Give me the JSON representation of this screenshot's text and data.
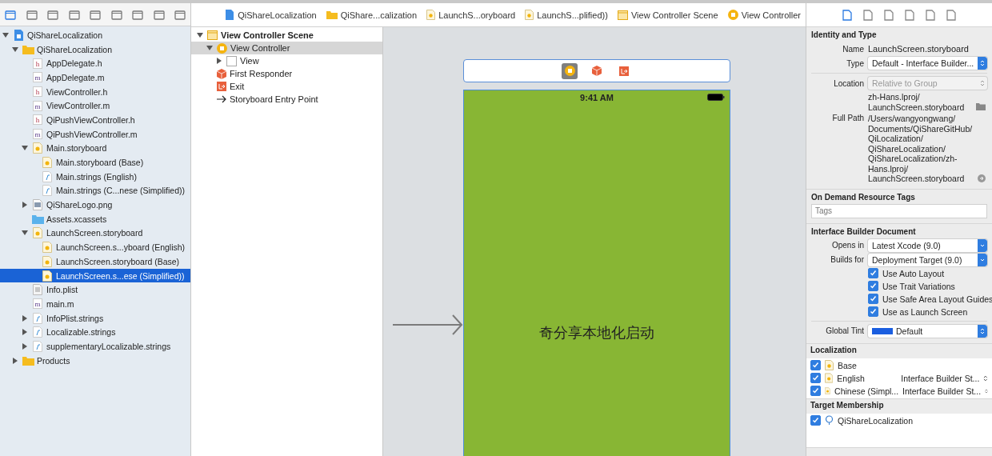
{
  "navigator": {
    "toolbar": [
      {
        "selected": true
      },
      {
        "selected": false
      },
      {
        "selected": false
      },
      {
        "selected": false
      },
      {
        "selected": false
      },
      {
        "selected": false
      },
      {
        "selected": false
      },
      {
        "selected": false
      },
      {
        "selected": false
      }
    ],
    "tree": [
      {
        "name": "QiShareLocalization",
        "kind": "project",
        "expanded": true,
        "selected": false,
        "children": [
          {
            "name": "QiShareLocalization",
            "kind": "folder",
            "expanded": true,
            "selected": false,
            "children": [
              {
                "name": "AppDelegate.h",
                "kind": "h",
                "selected": false
              },
              {
                "name": "AppDelegate.m",
                "kind": "m",
                "selected": false
              },
              {
                "name": "ViewController.h",
                "kind": "h",
                "selected": false
              },
              {
                "name": "ViewController.m",
                "kind": "m",
                "selected": false
              },
              {
                "name": "QiPushViewController.h",
                "kind": "h",
                "selected": false
              },
              {
                "name": "QiPushViewController.m",
                "kind": "m",
                "selected": false
              },
              {
                "name": "Main.storyboard",
                "kind": "storyboard",
                "expanded": true,
                "selected": false,
                "children": [
                  {
                    "name": "Main.storyboard (Base)",
                    "kind": "storyboard",
                    "selected": false
                  },
                  {
                    "name": "Main.strings (English)",
                    "kind": "strings",
                    "selected": false
                  },
                  {
                    "name": "Main.strings (C...nese (Simplified))",
                    "kind": "strings",
                    "selected": false
                  }
                ]
              },
              {
                "name": "QiShareLogo.png",
                "kind": "png",
                "expanded": false,
                "selected": false
              },
              {
                "name": "Assets.xcassets",
                "kind": "xcassets",
                "selected": false
              },
              {
                "name": "LaunchScreen.storyboard",
                "kind": "storyboard",
                "expanded": true,
                "selected": false,
                "children": [
                  {
                    "name": "LaunchScreen.s...yboard (English)",
                    "kind": "storyboard",
                    "selected": false
                  },
                  {
                    "name": "LaunchScreen.storyboard (Base)",
                    "kind": "storyboard",
                    "selected": false
                  },
                  {
                    "name": "LaunchScreen.s...ese (Simplified))",
                    "kind": "storyboard",
                    "selected": true
                  }
                ]
              },
              {
                "name": "Info.plist",
                "kind": "plist",
                "selected": false
              },
              {
                "name": "main.m",
                "kind": "m",
                "selected": false
              },
              {
                "name": "InfoPlist.strings",
                "kind": "strings",
                "expanded": false,
                "selected": false
              },
              {
                "name": "Localizable.strings",
                "kind": "strings",
                "expanded": false,
                "selected": false
              },
              {
                "name": "supplementaryLocalizable.strings",
                "kind": "strings",
                "expanded": false,
                "selected": false
              }
            ]
          },
          {
            "name": "Products",
            "kind": "folder",
            "expanded": false,
            "selected": false
          }
        ]
      }
    ]
  },
  "breadcrumb": [
    {
      "label": "QiShareLocalization",
      "kind": "project"
    },
    {
      "label": "QiShare...calization",
      "kind": "folder"
    },
    {
      "label": "LaunchS...oryboard",
      "kind": "storyboard"
    },
    {
      "label": "LaunchS...plified))",
      "kind": "storyboard"
    },
    {
      "label": "View Controller Scene",
      "kind": "scene"
    },
    {
      "label": "View Controller",
      "kind": "controller"
    }
  ],
  "outline": [
    {
      "name": "View Controller Scene",
      "kind": "scene",
      "expanded": true,
      "selected": false,
      "children": [
        {
          "name": "View Controller",
          "kind": "controller",
          "expanded": true,
          "selected": true,
          "children": [
            {
              "name": "View",
              "kind": "view",
              "expanded": false,
              "selected": false
            }
          ]
        },
        {
          "name": "First Responder",
          "kind": "responder",
          "selected": false
        },
        {
          "name": "Exit",
          "kind": "exit",
          "selected": false
        },
        {
          "name": "Storyboard Entry Point",
          "kind": "entry",
          "selected": false
        }
      ]
    }
  ],
  "canvas": {
    "scene_bar": [
      {
        "kind": "controller",
        "selected": true
      },
      {
        "kind": "responder",
        "selected": false
      },
      {
        "kind": "exit",
        "selected": false
      }
    ],
    "status_time": "9:41 AM",
    "label": "奇分享本地化启动"
  },
  "inspector": {
    "tabs": [
      {
        "selected": true
      },
      {
        "selected": false
      },
      {
        "selected": false
      },
      {
        "selected": false
      },
      {
        "selected": false
      },
      {
        "selected": false
      }
    ],
    "identity": {
      "title": "Identity and Type",
      "name_label": "Name",
      "name": "LaunchScreen.storyboard",
      "type_label": "Type",
      "type": "Default - Interface Builder...",
      "location_label": "Location",
      "location": "Relative to Group",
      "location_path": "zh-Hans.lproj/\nLaunchScreen.storyboard",
      "full_path_label": "Full Path",
      "full_path": "/Users/wangyongwang/\nDocuments/QiShareGitHub/\nQiLocalization/\nQiShareLocalization/\nQiShareLocalization/zh-\nHans.lproj/\nLaunchScreen.storyboard"
    },
    "tags": {
      "title": "On Demand Resource Tags",
      "placeholder": "Tags"
    },
    "ib_document": {
      "title": "Interface Builder Document",
      "opens_label": "Opens in",
      "opens": "Latest Xcode (9.0)",
      "builds_label": "Builds for",
      "builds": "Deployment Target (9.0)",
      "options": [
        {
          "label": "Use Auto Layout",
          "checked": true
        },
        {
          "label": "Use Trait Variations",
          "checked": true
        },
        {
          "label": "Use Safe Area Layout Guides",
          "checked": true
        },
        {
          "label": "Use as Launch Screen",
          "checked": true
        }
      ],
      "tint_label": "Global Tint",
      "tint": "Default"
    },
    "localization": {
      "title": "Localization",
      "items": [
        {
          "name": "Base",
          "checked": true
        },
        {
          "name": "English",
          "type": "Interface Builder St...",
          "checked": true
        },
        {
          "name": "Chinese (Simpl...",
          "type": "Interface Builder St...",
          "checked": true
        }
      ]
    },
    "membership": {
      "title": "Target Membership",
      "items": [
        {
          "name": "QiShareLocalization",
          "checked": true
        }
      ]
    }
  }
}
